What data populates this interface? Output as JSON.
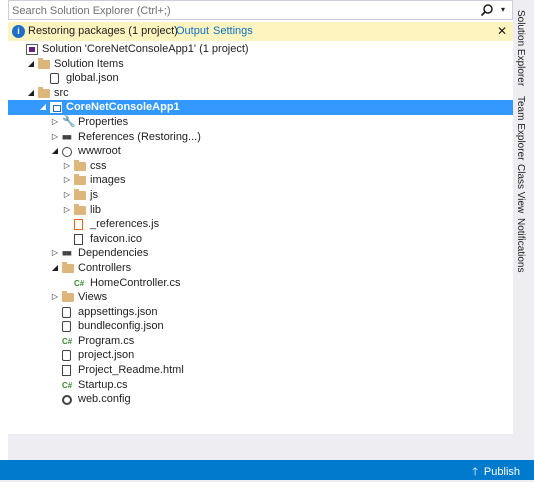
{
  "search": {
    "placeholder": "Search Solution Explorer (Ctrl+;)"
  },
  "info_bar": {
    "message": "Restoring packages (1 project)",
    "output_link": "Output",
    "settings_link": "Settings",
    "close": "✕"
  },
  "tree": [
    {
      "name": "Solution 'CoreNetConsoleApp1' (1 project)",
      "icon": "solution-icon",
      "expander": "none"
    },
    {
      "name": "Solution Items",
      "icon": "folder-icon",
      "expander": "expanded"
    },
    {
      "name": "global.json",
      "icon": "json-file-icon",
      "expander": "none"
    },
    {
      "name": "src",
      "icon": "folder-icon",
      "expander": "expanded"
    },
    {
      "name": "CoreNetConsoleApp1",
      "icon": "project-icon",
      "expander": "expanded",
      "selected": true
    },
    {
      "name": "Properties",
      "icon": "wrench-icon",
      "expander": "collapsed"
    },
    {
      "name": "References (Restoring...)",
      "icon": "references-icon",
      "expander": "collapsed"
    },
    {
      "name": "wwwroot",
      "icon": "globe-icon",
      "expander": "expanded"
    },
    {
      "name": "css",
      "icon": "folder-icon",
      "expander": "collapsed"
    },
    {
      "name": "images",
      "icon": "folder-icon",
      "expander": "collapsed"
    },
    {
      "name": "js",
      "icon": "folder-icon",
      "expander": "collapsed"
    },
    {
      "name": "lib",
      "icon": "folder-icon",
      "expander": "collapsed"
    },
    {
      "name": "_references.js",
      "icon": "js-file-icon",
      "expander": "none"
    },
    {
      "name": "favicon.ico",
      "icon": "ico-file-icon",
      "expander": "none"
    },
    {
      "name": "Dependencies",
      "icon": "references-icon",
      "expander": "collapsed"
    },
    {
      "name": "Controllers",
      "icon": "folder-icon",
      "expander": "expanded"
    },
    {
      "name": "HomeController.cs",
      "icon": "csharp-file-icon",
      "expander": "none"
    },
    {
      "name": "Views",
      "icon": "folder-icon",
      "expander": "collapsed"
    },
    {
      "name": "appsettings.json",
      "icon": "json-file-icon",
      "expander": "none"
    },
    {
      "name": "bundleconfig.json",
      "icon": "json-file-icon",
      "expander": "none"
    },
    {
      "name": "Program.cs",
      "icon": "csharp-file-icon",
      "expander": "none"
    },
    {
      "name": "project.json",
      "icon": "json-file-icon",
      "expander": "none"
    },
    {
      "name": "Project_Readme.html",
      "icon": "html-file-icon",
      "expander": "none"
    },
    {
      "name": "Startup.cs",
      "icon": "csharp-file-icon",
      "expander": "none"
    },
    {
      "name": "web.config",
      "icon": "config-file-icon",
      "expander": "none"
    }
  ],
  "right_tabs": [
    "Solution Explorer",
    "Team Explorer",
    "Class View",
    "Notifications"
  ],
  "status_bar": {
    "publish_label": "Publish",
    "publish_arrow": "🡑"
  },
  "colors": {
    "selection": "#3399ff",
    "info_bar": "#fdf4bf",
    "status_bar": "#007acc",
    "link": "#0e70c0"
  }
}
